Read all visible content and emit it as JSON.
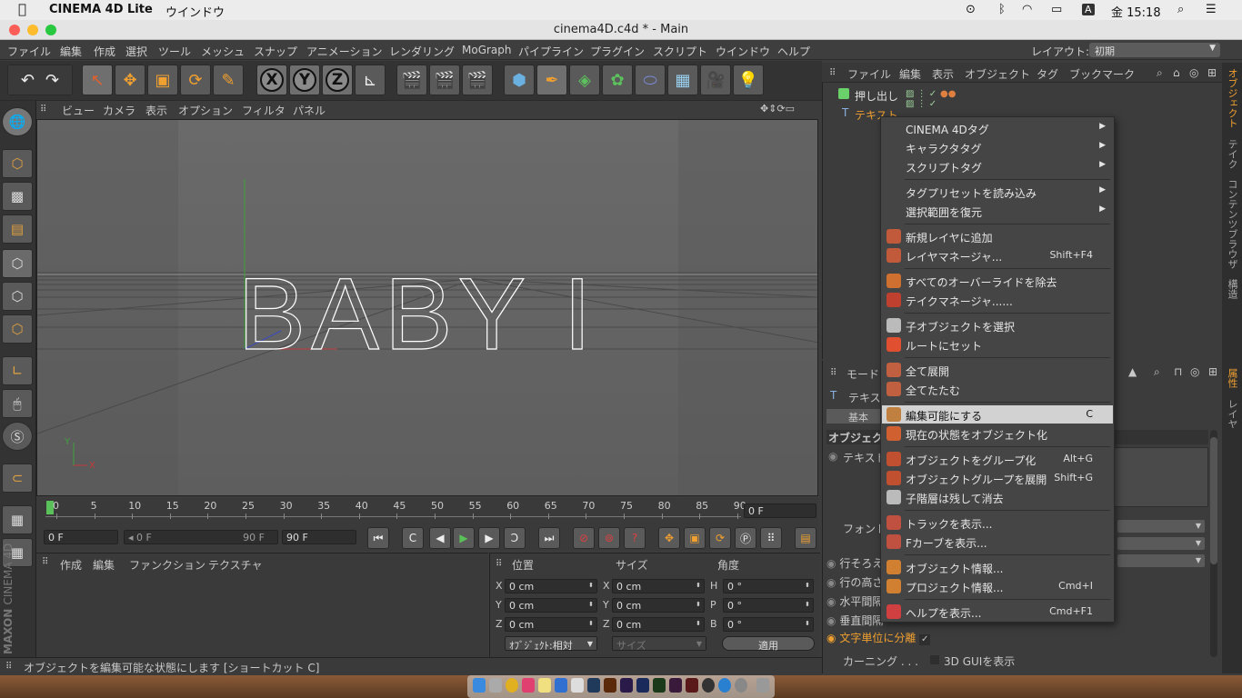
{
  "mac_menubar": {
    "apple_icon": "apple-icon",
    "app_name": "CINEMA 4D Lite",
    "menu": "ウインドウ",
    "input_badge": "A",
    "clock": "金 15:18"
  },
  "window": {
    "title": "cinema4D.c4d * - Main"
  },
  "app_menu": [
    "ファイル",
    "編集",
    "作成",
    "選択",
    "ツール",
    "メッシュ",
    "スナップ",
    "アニメーション",
    "レンダリング",
    "MoGraph",
    "パイプライン",
    "プラグイン",
    "スクリプト",
    "ウインドウ",
    "ヘルプ"
  ],
  "layout": {
    "label": "レイアウト:",
    "value": "初期"
  },
  "toolbar": {
    "x": "X",
    "y": "Y",
    "z": "Z"
  },
  "viewport_menu": [
    "ビュー",
    "カメラ",
    "表示",
    "オプション",
    "フィルタ",
    "パネル"
  ],
  "viewport": {
    "text_object": "BABY I",
    "axis_y": "Y",
    "axis_x": "X"
  },
  "timeline": {
    "ticks": [
      "0",
      "5",
      "10",
      "15",
      "20",
      "25",
      "30",
      "35",
      "40",
      "45",
      "50",
      "55",
      "60",
      "65",
      "70",
      "75",
      "80",
      "85",
      "90"
    ],
    "current": "0 F"
  },
  "transport": {
    "start": "0 F",
    "range_start": "0 F",
    "range_end": "90 F",
    "end": "90 F"
  },
  "material_menu": [
    "作成",
    "編集",
    "ファンクション",
    "テクスチャ"
  ],
  "coords": {
    "headers": [
      "位置",
      "サイズ",
      "角度"
    ],
    "rows": [
      {
        "a": "X",
        "av": "0 cm",
        "b": "X",
        "bv": "0 cm",
        "c": "H",
        "cv": "0 °"
      },
      {
        "a": "Y",
        "av": "0 cm",
        "b": "Y",
        "bv": "0 cm",
        "c": "P",
        "cv": "0 °"
      },
      {
        "a": "Z",
        "av": "0 cm",
        "b": "Z",
        "bv": "0 cm",
        "c": "B",
        "cv": "0 °"
      }
    ],
    "mode": "ｵﾌﾞｼﾞｪｸﾄ:相対",
    "size_mode": "サイズ",
    "apply": "適用"
  },
  "status": "オブジェクトを編集可能な状態にします [ショートカット C]",
  "object_menu": [
    "ファイル",
    "編集",
    "表示",
    "オブジェクト",
    "タグ",
    "ブックマーク"
  ],
  "objects": [
    "押し出し",
    "テキスト"
  ],
  "attr": {
    "mode": "モード",
    "obj_label": "テキスト",
    "tab_basic": "基本",
    "section": "オブジェクト",
    "text_label": "テキスト",
    "font_label": "フォント",
    "rows": [
      "行そろえ",
      "行の高さ",
      "水平間隔",
      "垂直間隔"
    ],
    "per_char": "文字単位に分離",
    "kerning": "カーニング . . .",
    "gui3d": "3D GUIを表示"
  },
  "side_tabs": [
    "オブジェクト",
    "テイク",
    "コンテンツブラウザ",
    "構造",
    "属性",
    "レイヤ"
  ],
  "maxon": {
    "brand": "MAXON",
    "product": "CINEMA 4D"
  },
  "context_menu": [
    {
      "label": "CINEMA 4Dタグ",
      "arrow": "▶"
    },
    {
      "label": "キャラクタタグ",
      "arrow": "▶"
    },
    {
      "label": "スクリプトタグ",
      "arrow": "▶"
    },
    {
      "sep": true
    },
    {
      "label": "タグプリセットを読み込み",
      "arrow": "▶"
    },
    {
      "label": "選択範囲を復元",
      "arrow": "▶"
    },
    {
      "sep": true
    },
    {
      "label": "新規レイヤに追加",
      "icon": "#c05a3a"
    },
    {
      "label": "レイヤマネージャ...",
      "shortcut": "Shift+F4",
      "icon": "#c05a3a"
    },
    {
      "sep": true
    },
    {
      "label": "すべてのオーバーライドを除去",
      "icon": "#d07030"
    },
    {
      "label": "テイクマネージャ......",
      "icon": "#c04030"
    },
    {
      "sep": true
    },
    {
      "label": "子オブジェクトを選択",
      "icon": "#bbbbbb"
    },
    {
      "label": "ルートにセット",
      "icon": "#e05030"
    },
    {
      "sep": true
    },
    {
      "label": "全て展開",
      "icon": "#c06040"
    },
    {
      "label": "全てたたむ",
      "icon": "#c06040"
    },
    {
      "sep": true
    },
    {
      "label": "編集可能にする",
      "shortcut": "C",
      "icon": "#c08040",
      "hl": true
    },
    {
      "label": "現在の状態をオブジェクト化",
      "icon": "#d06030"
    },
    {
      "sep": true
    },
    {
      "label": "オブジェクトをグループ化",
      "shortcut": "Alt+G",
      "icon": "#c05030"
    },
    {
      "label": "オブジェクトグループを展開",
      "shortcut": "Shift+G",
      "icon": "#c05030"
    },
    {
      "label": "子階層は残して消去",
      "icon": "#bbbbbb"
    },
    {
      "sep": true
    },
    {
      "label": "トラックを表示...",
      "icon": "#c05040"
    },
    {
      "label": "Fカーブを表示...",
      "icon": "#c05040"
    },
    {
      "sep": true
    },
    {
      "label": "オブジェクト情報...",
      "icon": "#d08030"
    },
    {
      "label": "プロジェクト情報...",
      "shortcut": "Cmd+I",
      "icon": "#d08030"
    },
    {
      "sep": true
    },
    {
      "label": "ヘルプを表示...",
      "shortcut": "Cmd+F1",
      "icon": "#d04040"
    }
  ]
}
